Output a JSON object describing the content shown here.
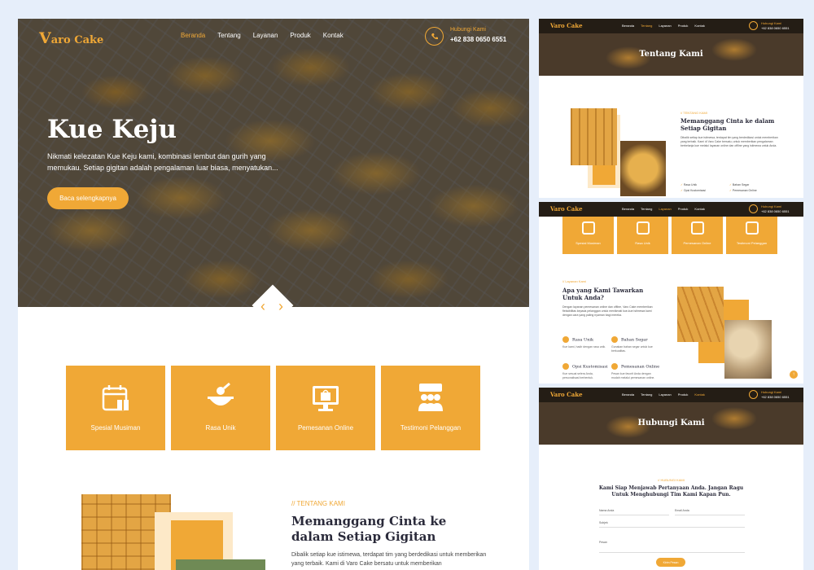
{
  "brand": {
    "logo": "Varo Cake",
    "logo_initial": "V",
    "logo_rest": "aro Cake",
    "accent": "#f0a836",
    "dark": "#241d15"
  },
  "nav": {
    "items": [
      "Beranda",
      "Tentang",
      "Layanan",
      "Produk",
      "Kontak"
    ],
    "active": "Beranda",
    "phone_label": "Hubungi Kami",
    "phone_number": "+62 838 0650 6551"
  },
  "hero": {
    "title": "Kue Keju",
    "text": "Nikmati kelezatan Kue Keju kami, kombinasi lembut dan gurih yang memukau. Setiap gigitan adalah pengalaman luar biasa, menyatukan...",
    "button": "Baca selengkapnya",
    "prev_icon": "‹",
    "next_icon": "›"
  },
  "features": [
    {
      "label": "Spesial Musiman",
      "icon": "calendar-gift-icon"
    },
    {
      "label": "Rasa Unik",
      "icon": "mixing-bowl-icon"
    },
    {
      "label": "Pemesanan Online",
      "icon": "monitor-bag-icon"
    },
    {
      "label": "Testimoni Pelanggan",
      "icon": "customers-icon"
    }
  ],
  "about": {
    "tag": "// TENTANG KAMI",
    "title": "Memanggang Cinta ke dalam Setiap Gigitan",
    "text": "Dibalik setiap kue istimewa, terdapat tim yang berdedikasi untuk memberikan yang terbaik. Kami di Varo Cake bersatu untuk memberikan"
  },
  "thumb_about": {
    "nav_active": "Tentang",
    "banner": "Tentang Kami",
    "tag": "// TENTANG KAMI",
    "title": "Memanggang Cinta ke dalam Setiap Gigitan",
    "text": "Dibalik setiap kue istimewa, terdapat tim yang berdedikasi untuk memberikan yang terbaik. Kami di Varo Cake bersatu, untuk memberikan pengalaman berbelanja kue melalui layanan online dan offline yang istimewa untuk Anda.",
    "checks": [
      "Rasa Unik",
      "Bahan Segar",
      "Opsi Kustomisasi",
      "Pemesanan Online"
    ]
  },
  "thumb_services": {
    "nav_active": "Layanan",
    "cards": [
      "Spesial Musiman",
      "Rasa Unik",
      "Pemesanan Online",
      "Testimoni Pelanggan"
    ],
    "tag": "// Layanan Kami",
    "title": "Apa yang Kami Tawarkan Untuk Anda?",
    "text": "Dengan layanan pemesanan online dan offline, Varo Cake memberikan fleksibilitas kepada pelanggan untuk menikmati kue-kue istimewa kami dengan cara yang paling nyaman bagi mereka.",
    "services": [
      {
        "name": "Rasa Unik",
        "desc": "Kue kami, hadir dengan rasa unik."
      },
      {
        "name": "Bahan Segar",
        "desc": "Gunakan bahan segar untuk kue berkualitas."
      },
      {
        "name": "Opsi Kustomisasi",
        "desc": "Kue sesuai selera Anda, personalisasi berbentuk."
      },
      {
        "name": "Pemesanan Online",
        "desc": "Pesan kue favorit Anda dengan mudah melalui pemesanan online."
      }
    ],
    "scroll_icon": "↑"
  },
  "thumb_contact": {
    "nav_active": "Kontak",
    "banner": "Hubungi Kami",
    "tag": "// HUBUNGI KAMI",
    "title": "Kami Siap Menjawab Pertanyaan Anda. Jangan Ragu Untuk Menghubungi Tim Kami Kapan Pun.",
    "fields": {
      "name": "Nama Anda",
      "email": "Email Anda",
      "subject": "Subjek",
      "message": "Pesan"
    },
    "button": "Kirim Pesan"
  }
}
